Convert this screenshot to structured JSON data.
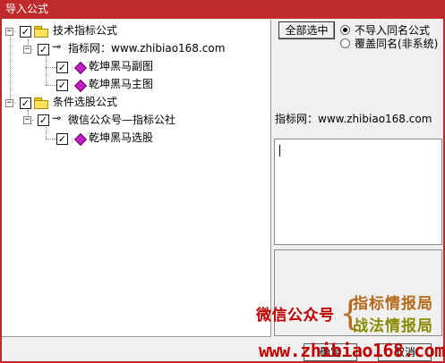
{
  "window": {
    "title": "导入公式"
  },
  "tree": {
    "groups": [
      {
        "label": "技术指标公式",
        "checked": true,
        "children": [
          {
            "label": "指标网：www.zhibiao168.com",
            "checked": true,
            "items": [
              {
                "label": "乾坤黑马副图",
                "checked": true
              },
              {
                "label": "乾坤黑马主图",
                "checked": true
              }
            ]
          }
        ]
      },
      {
        "label": "条件选股公式",
        "checked": true,
        "children": [
          {
            "label": "微信公众号—指标公社",
            "checked": true,
            "items": [
              {
                "label": "乾坤黑马选股",
                "checked": true
              }
            ]
          }
        ]
      }
    ]
  },
  "controls": {
    "select_all_label": "全部选中",
    "radio_options": [
      {
        "label": "不导入同名公式",
        "selected": true
      },
      {
        "label": "覆盖同名(非系统)",
        "selected": false
      }
    ],
    "info_text": "指标网：www.zhibiao168.com"
  },
  "watermark": {
    "wechat_label": "微信公众号",
    "line1": "指标情报局",
    "line2": "战法情报局",
    "url": "www.zhibiao168.com"
  },
  "buttons": {
    "ok_label": "确定",
    "cancel_label": "取消"
  },
  "colors": {
    "title_bar": "#bf2b2c",
    "watermark_red": "#c00000",
    "watermark_orange": "#b46a1a",
    "watermark_olive": "#8a8a00"
  }
}
